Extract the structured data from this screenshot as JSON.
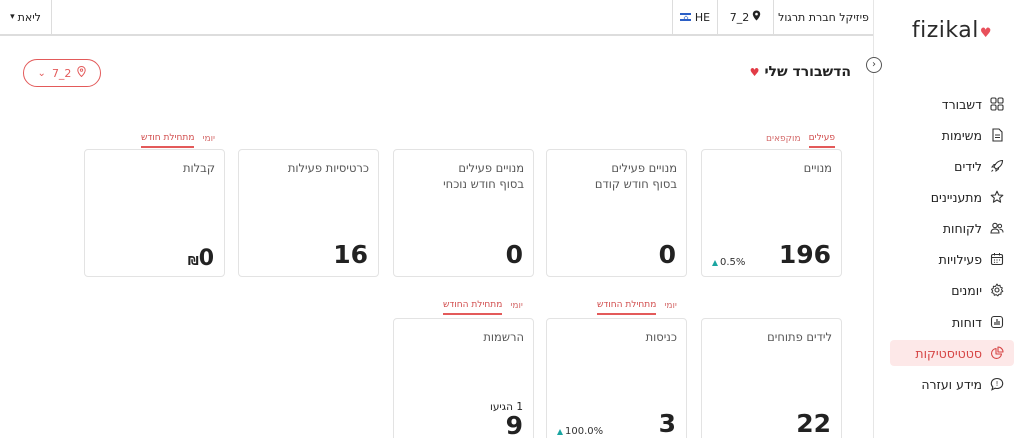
{
  "app": {
    "logo_text": "fizikal",
    "logo_heart": "♥"
  },
  "topbar": {
    "user_label": "ליאת",
    "company": "פיזיקל חברת תרגול",
    "branch": "7_2",
    "language": "HE"
  },
  "page": {
    "title": "הדשבורד שלי",
    "branch_select": "7_2"
  },
  "sidebar": {
    "collapse_glyph": "›",
    "items": [
      {
        "label": "דשבורד",
        "icon": "grid-icon"
      },
      {
        "label": "משימות",
        "icon": "document-icon"
      },
      {
        "label": "לידים",
        "icon": "rocket-icon"
      },
      {
        "label": "מתעניינים",
        "icon": "star-icon"
      },
      {
        "label": "לקוחות",
        "icon": "users-icon"
      },
      {
        "label": "פעילויות",
        "icon": "calendar-icon"
      },
      {
        "label": "יומנים",
        "icon": "gear-icon"
      },
      {
        "label": "דוחות",
        "icon": "report-icon"
      },
      {
        "label": "סטטיסטיקות",
        "icon": "pie-chart-icon",
        "active": true
      },
      {
        "label": "מידע ועזרה",
        "icon": "help-icon"
      }
    ]
  },
  "tabs": {
    "members": {
      "active": "פעילים",
      "other": "מוקפאים"
    },
    "receipts": {
      "active": "מתחילת חודש",
      "other": "יומי"
    },
    "entries": {
      "active": "מתחילת החודש",
      "other": "יומי"
    },
    "registrations": {
      "active": "מתחילת החודש",
      "other": "יומי"
    }
  },
  "cards": {
    "members": {
      "title": "מנויים",
      "value": "196",
      "change": "0.5%"
    },
    "active_end_prev": {
      "title_line1": "מנויים פעילים",
      "title_line2": "בסוף חודש קודם",
      "value": "0"
    },
    "active_end_curr": {
      "title_line1": "מנויים פעילים",
      "title_line2": "בסוף חודש נוכחי",
      "value": "0"
    },
    "activity_cards": {
      "title": "כרטיסיות פעילות",
      "value": "16"
    },
    "receipts": {
      "title": "קבלות",
      "value": "0",
      "currency": "₪"
    },
    "open_leads": {
      "title": "לידים פתוחים",
      "value": "22"
    },
    "entries": {
      "title": "כניסות",
      "value": "3",
      "change": "100.0%"
    },
    "registrations": {
      "title": "הרשמות",
      "value": "9",
      "sub": "1 הגיעו"
    }
  },
  "colors": {
    "accent": "#e35a5a",
    "active_bg": "#fde8e8",
    "up_arrow": "#1aa5a1"
  }
}
